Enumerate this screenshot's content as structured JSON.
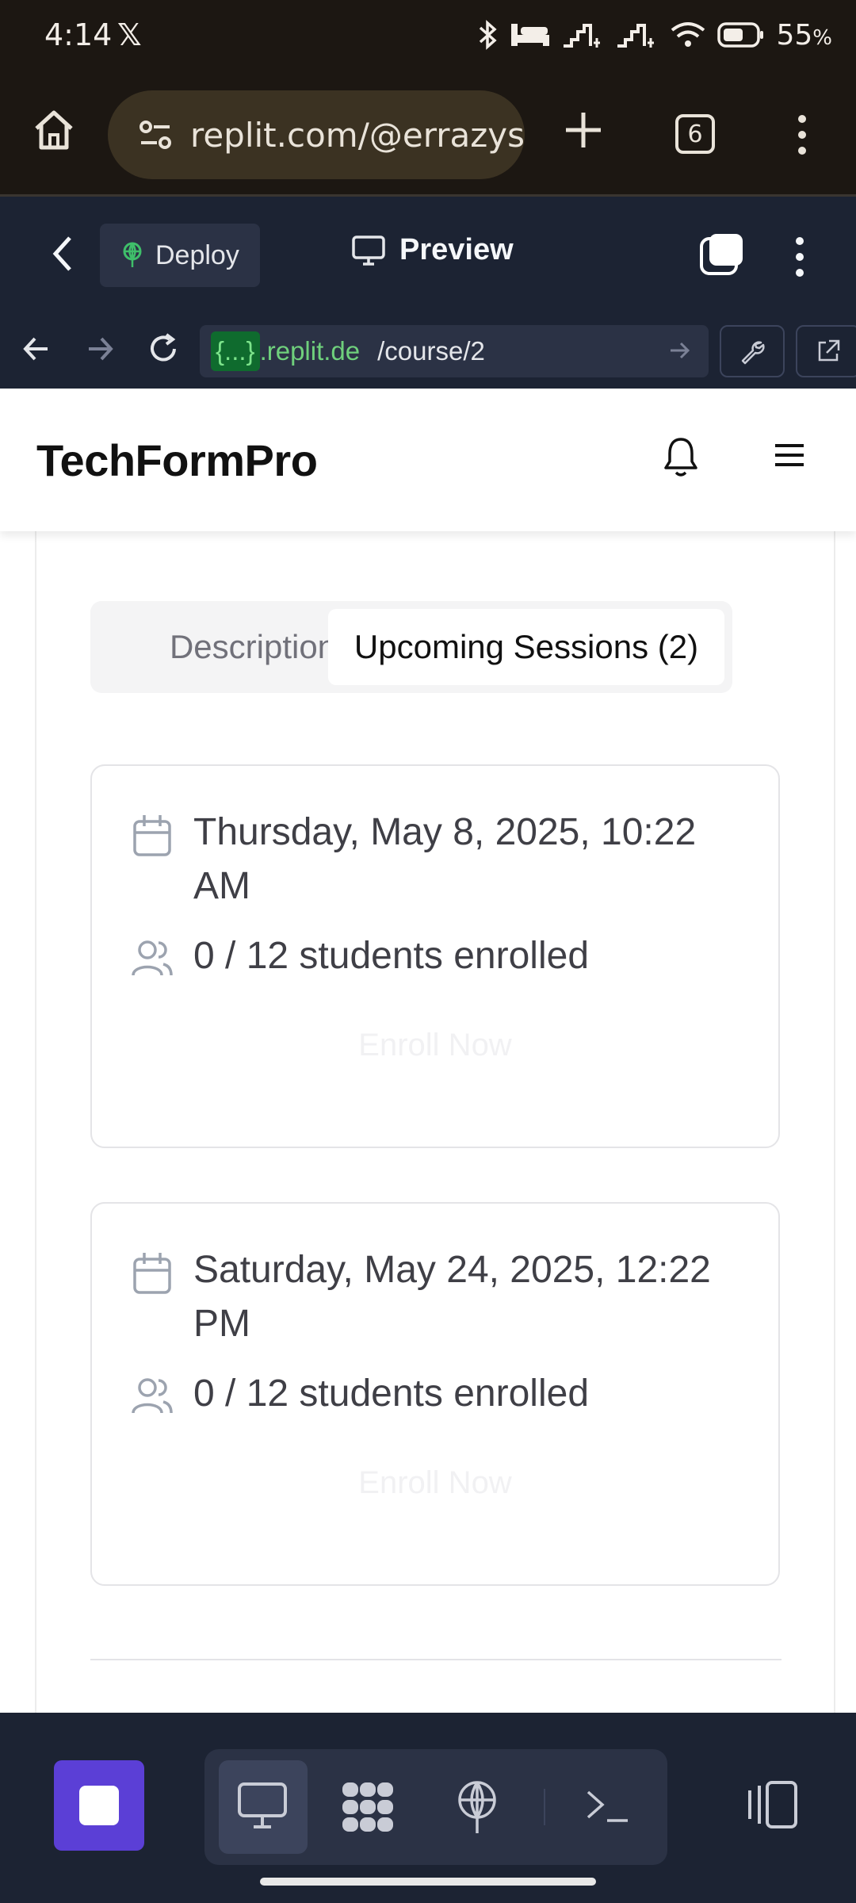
{
  "status_bar": {
    "time": "4:14",
    "battery": "55",
    "battery_unit": "%"
  },
  "browser": {
    "url": "replit.com/@errazysı",
    "tab_count": "6"
  },
  "replit_header": {
    "deploy_label": "Deploy",
    "preview_label": "Preview"
  },
  "preview_bar": {
    "url_tag": "{...}",
    "url_host": ".replit.de",
    "url_path": "/course/2"
  },
  "site": {
    "brand": "TechFormPro",
    "tabs": [
      {
        "label": "Description",
        "active": false
      },
      {
        "label": "Upcoming Sessions (2)",
        "active": true
      }
    ],
    "sessions": [
      {
        "datetime": "Thursday, May 8, 2025, 10:22 AM",
        "enrollment": "0 / 12 students enrolled",
        "action": "Enroll Now"
      },
      {
        "datetime": "Saturday, May 24, 2025, 12:22 PM",
        "enrollment": "0 / 12 students enrolled",
        "action": "Enroll Now"
      }
    ]
  },
  "colors": {
    "replit_bg": "#1c2333",
    "chrome_bg": "#1c1712",
    "stop_button": "#5b3fd6",
    "url_host": "#6fd07c"
  }
}
